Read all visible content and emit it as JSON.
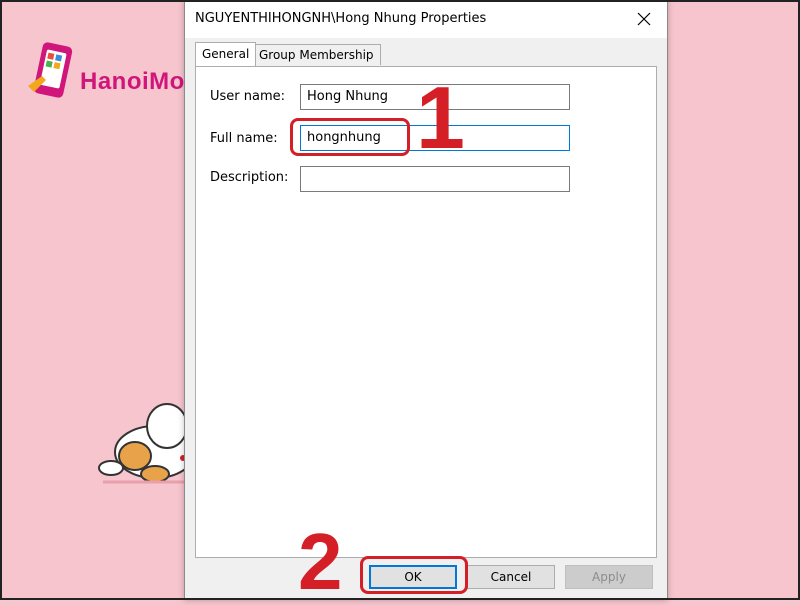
{
  "logo": {
    "text": "HanoiMobile"
  },
  "dialog": {
    "title": "NGUYENTHIHONGNH\\Hong Nhung Properties",
    "tabs": [
      {
        "label": "General",
        "active": true
      },
      {
        "label": "Group Membership",
        "active": false
      }
    ],
    "fields": {
      "user_name": {
        "label": "User name:",
        "value": "Hong Nhung"
      },
      "full_name": {
        "label": "Full name:",
        "value": "hongnhung"
      },
      "description": {
        "label": "Description:",
        "value": ""
      }
    },
    "buttons": {
      "ok": "OK",
      "cancel": "Cancel",
      "apply": "Apply"
    }
  },
  "annotations": {
    "step1": "1",
    "step2": "2",
    "color": "#d51f26"
  },
  "colors": {
    "background": "#f7c5ce",
    "focus_blue": "#0078d7",
    "brand": "#d0167a"
  }
}
